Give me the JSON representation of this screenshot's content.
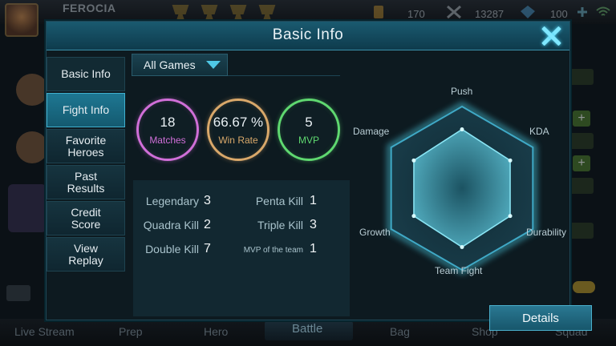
{
  "background": {
    "player_name": "FEROCIA",
    "stats": [
      "170",
      "13287",
      "100"
    ],
    "bottom_tabs": [
      "Live Stream",
      "Prep",
      "Hero",
      "Battle",
      "Bag",
      "Shop",
      "Squad"
    ],
    "colors": {
      "backdrop": "#0b1116",
      "accent": "#4fc8e6"
    }
  },
  "dialog": {
    "title": "Basic Info",
    "close_icon": "close-icon"
  },
  "nav": {
    "items": [
      {
        "label": "Basic Info"
      },
      {
        "label": "Fight Info"
      },
      {
        "label": "Favorite Heroes"
      },
      {
        "label": "Past Results"
      },
      {
        "label": "Credit Score"
      },
      {
        "label": "View Replay"
      }
    ],
    "active_index": 1
  },
  "filter": {
    "label": "All Games",
    "icon": "chevron-down-icon"
  },
  "rings": [
    {
      "value": "18",
      "label": "Matches",
      "color": "#d06fd8"
    },
    {
      "value": "66.67 %",
      "label": "Win Rate",
      "color": "#d9a86a"
    },
    {
      "value": "5",
      "label": "MVP",
      "color": "#5fd870"
    }
  ],
  "kills": [
    {
      "label": "Legendary",
      "value": "3"
    },
    {
      "label": "Quadra Kill",
      "value": "2"
    },
    {
      "label": "Double Kill",
      "value": "7"
    },
    {
      "label": "Penta Kill",
      "value": "1"
    },
    {
      "label": "Triple Kill",
      "value": "3"
    },
    {
      "label": "MVP of the team",
      "value": "1"
    }
  ],
  "radar": {
    "axes": [
      "Push",
      "KDA",
      "Durability",
      "Team Fight",
      "Growth",
      "Damage"
    ],
    "values": [
      0.72,
      0.68,
      0.68,
      0.72,
      0.68,
      0.68
    ],
    "color": "#4fd8f0"
  },
  "details_label": "Details"
}
